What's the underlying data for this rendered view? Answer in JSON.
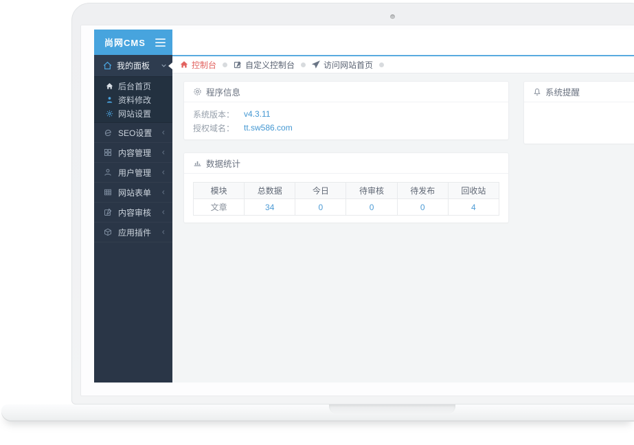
{
  "window": {
    "logo_text": "尚网CMS"
  },
  "sidebar": {
    "group": {
      "label": "我的面板"
    },
    "submenu": [
      {
        "label": "后台首页"
      },
      {
        "label": "资料修改"
      },
      {
        "label": "网站设置"
      }
    ],
    "items": [
      {
        "label": "SEO设置"
      },
      {
        "label": "内容管理"
      },
      {
        "label": "用户管理"
      },
      {
        "label": "网站表单"
      },
      {
        "label": "内容审核"
      },
      {
        "label": "应用插件"
      }
    ]
  },
  "breadcrumb": {
    "items": [
      {
        "label": "控制台",
        "active": true
      },
      {
        "label": "自定义控制台",
        "active": false
      },
      {
        "label": "访问网站首页",
        "active": false
      }
    ]
  },
  "panels": {
    "program_info": {
      "title": "程序信息",
      "rows": [
        {
          "label": "系统版本：",
          "value": "v4.3.11"
        },
        {
          "label": "授权域名：",
          "value": "tt.sw586.com"
        }
      ]
    },
    "system_alert": {
      "title": "系统提醒"
    },
    "data_stats": {
      "title": "数据统计",
      "table": {
        "headers": [
          "模块",
          "总数据",
          "今日",
          "待审核",
          "待发布",
          "回收站"
        ],
        "rows": [
          [
            "文章",
            "34",
            "0",
            "0",
            "0",
            "4"
          ]
        ]
      }
    }
  },
  "colors": {
    "brand_blue": "#47a4de",
    "sidebar_bg": "#2a3647",
    "link_blue": "#4397d2",
    "active_red": "#e2625f",
    "content_bg": "#f3f5f6"
  }
}
